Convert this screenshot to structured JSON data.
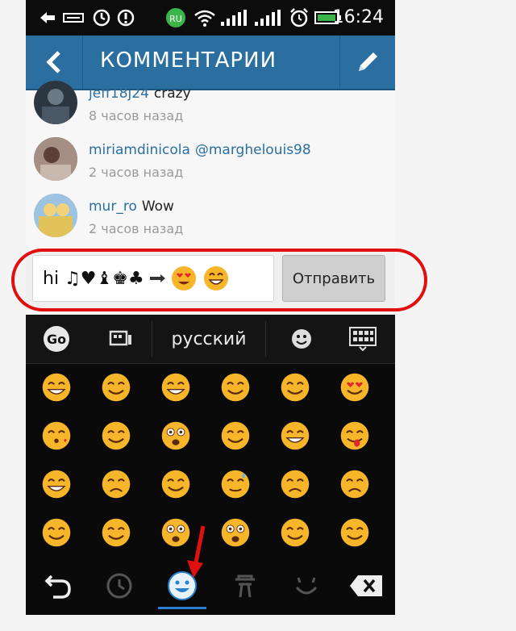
{
  "status_bar": {
    "time": "16:24"
  },
  "app_bar": {
    "title": "КОММЕНТАРИИ"
  },
  "comments": [
    {
      "username": "jeff18j24",
      "text": "crazy",
      "time": "8 часов назад"
    },
    {
      "username": "miriamdinicola",
      "mention": "@marghelouis98",
      "time": "2 часов назад"
    },
    {
      "username": "mur_ro",
      "text": "Wow",
      "time": "2 часов назад"
    }
  ],
  "input": {
    "value": "hi ♫♥♝♚♣",
    "send_label": "Отправить"
  },
  "keyboard": {
    "language": "русский"
  },
  "colors": {
    "accent": "#2a6fa0",
    "highlight": "#e01010",
    "emoji": "#f7b52a"
  }
}
